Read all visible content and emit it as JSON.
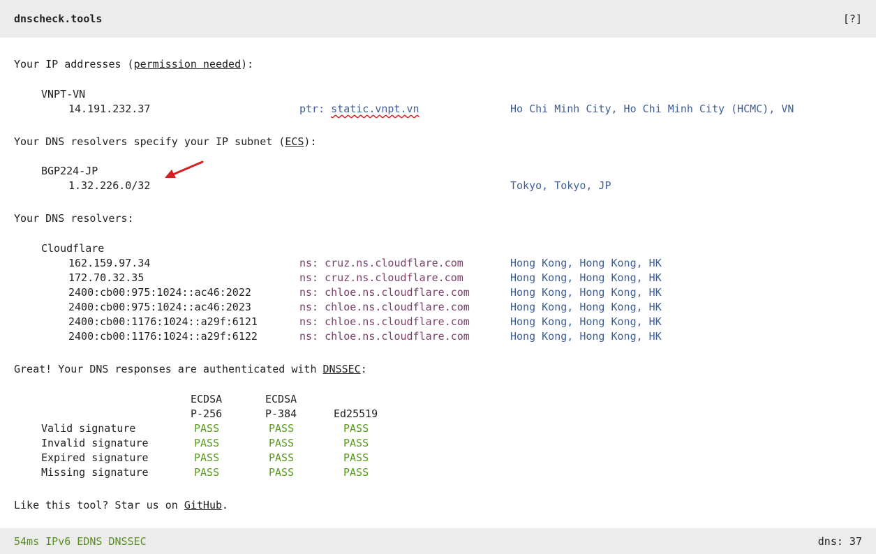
{
  "header": {
    "title": "dnscheck.tools",
    "help": "[?]"
  },
  "ip_section": {
    "heading_prefix": "Your IP addresses (",
    "heading_link": "permission needed",
    "heading_suffix": "):",
    "provider": "VNPT-VN",
    "ip": "14.191.232.37",
    "ptr_label": "ptr: ",
    "ptr_value": "static.vnpt.vn",
    "location": "Ho Chi Minh City, Ho Chi Minh City (HCMC), VN"
  },
  "ecs_section": {
    "heading_prefix": "Your DNS resolvers specify your IP subnet (",
    "heading_link": "ECS",
    "heading_suffix": "):",
    "provider": "BGP224-JP",
    "subnet": "1.32.226.0/32",
    "location": "Tokyo, Tokyo, JP",
    "arrow_color": "#d42020"
  },
  "resolvers_section": {
    "heading": "Your DNS resolvers:",
    "provider": "Cloudflare",
    "rows": [
      {
        "ip": "162.159.97.34",
        "ns": "ns: cruz.ns.cloudflare.com",
        "location": "Hong Kong, Hong Kong, HK"
      },
      {
        "ip": "172.70.32.35",
        "ns": "ns: cruz.ns.cloudflare.com",
        "location": "Hong Kong, Hong Kong, HK"
      },
      {
        "ip": "2400:cb00:975:1024::ac46:2022",
        "ns": "ns: chloe.ns.cloudflare.com",
        "location": "Hong Kong, Hong Kong, HK"
      },
      {
        "ip": "2400:cb00:975:1024::ac46:2023",
        "ns": "ns: chloe.ns.cloudflare.com",
        "location": "Hong Kong, Hong Kong, HK"
      },
      {
        "ip": "2400:cb00:1176:1024::a29f:6121",
        "ns": "ns: chloe.ns.cloudflare.com",
        "location": "Hong Kong, Hong Kong, HK"
      },
      {
        "ip": "2400:cb00:1176:1024::a29f:6122",
        "ns": "ns: chloe.ns.cloudflare.com",
        "location": "Hong Kong, Hong Kong, HK"
      }
    ]
  },
  "dnssec_section": {
    "heading_prefix": "Great! Your DNS responses are authenticated with ",
    "heading_link": "DNSSEC",
    "heading_suffix": ":",
    "columns": [
      {
        "line1": "ECDSA",
        "line2": "P-256"
      },
      {
        "line1": "ECDSA",
        "line2": "P-384"
      },
      {
        "line1": "",
        "line2": "Ed25519"
      }
    ],
    "rows": [
      {
        "label": "Valid signature",
        "results": [
          "PASS",
          "PASS",
          "PASS"
        ]
      },
      {
        "label": "Invalid signature",
        "results": [
          "PASS",
          "PASS",
          "PASS"
        ]
      },
      {
        "label": "Expired signature",
        "results": [
          "PASS",
          "PASS",
          "PASS"
        ]
      },
      {
        "label": "Missing signature",
        "results": [
          "PASS",
          "PASS",
          "PASS"
        ]
      }
    ]
  },
  "footer_note": {
    "prefix": "Like this tool? Star us on ",
    "link": "GitHub",
    "suffix": "."
  },
  "footer": {
    "status": "54ms IPv6 EDNS DNSSEC",
    "dns_count": "dns: 37"
  },
  "colors": {
    "location": "#3f5f94",
    "hostname": "#7a3f6b",
    "pass": "#5a9b1e",
    "status": "#5a8f1e",
    "bar_background": "#ececec"
  }
}
